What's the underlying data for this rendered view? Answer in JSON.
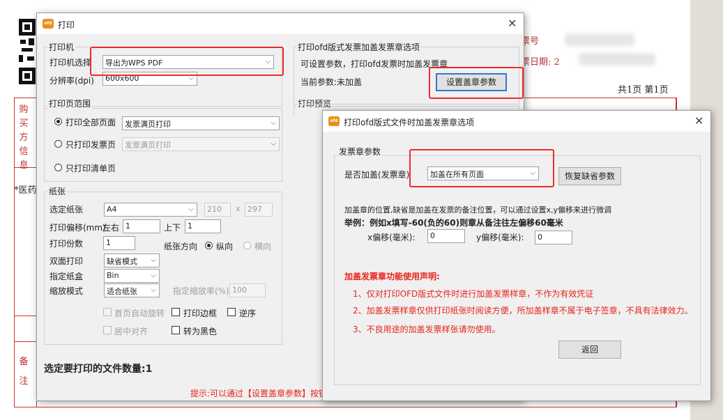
{
  "background_invoice": {
    "invoice_number_label": "票号",
    "invoice_date_label": "票日期: 2",
    "page_count": "共1页  第1页",
    "buyer_label_chars": [
      "购",
      "买",
      "方",
      "信",
      "息"
    ],
    "item_fragment": "*医药",
    "notes_label_chars": [
      "备",
      "注"
    ]
  },
  "print_dialog": {
    "title": "打印",
    "app_icon_label": "ofd",
    "printer_group": {
      "label": "打印机",
      "printer_select_label": "打印机选择",
      "printer_select_value": "导出为WPS PDF",
      "resolution_label": "分辨率(dpi)",
      "resolution_value": "600x600"
    },
    "stamp_options_group": {
      "label": "打印ofd版式发票加盖发票章选项",
      "description": "可设置参数，打印ofd发票时加盖发票章",
      "current_params": "当前参数:未加盖",
      "set_params_button": "设置盖章参数"
    },
    "range_group": {
      "label": "打印页范围",
      "all_pages_label": "打印全部页面",
      "all_pages_select": "发票满页打印",
      "invoice_only_label": "只打印发票页",
      "invoice_only_select": "发票满页打印",
      "list_only_label": "只打印清单页"
    },
    "preview_label": "打印预览",
    "paper_group": {
      "label": "纸张",
      "paper_select_label": "选定纸张",
      "paper_value": "A4",
      "paper_width": "210",
      "times": "x",
      "paper_height": "297",
      "offset_label": "打印偏移(mm)",
      "left_right_label": "左右",
      "left_right_value": "1",
      "up_down_label": "上下",
      "up_down_value": "1",
      "copies_label": "打印份数",
      "copies_value": "1",
      "orientation_label": "纸张方向",
      "portrait_label": "纵向",
      "landscape_label": "横向",
      "duplex_label": "双面打印",
      "duplex_value": "缺省模式",
      "tray_label": "指定纸盒",
      "tray_value": "Bin",
      "scale_mode_label": "缩放模式",
      "scale_mode_value": "适合纸张",
      "scale_ratio_label": "指定缩放率(%)",
      "scale_ratio_value": "100",
      "auto_rotate_label": "首页自动旋转",
      "print_border_label": "打印边框",
      "reverse_label": "逆序",
      "center_label": "居中对齐",
      "black_label": "转为黑色"
    },
    "file_count": "选定要打印的文件数量:1",
    "hint": "提示:可以通过【设置盖章参数】按钮"
  },
  "stamp_dialog": {
    "title": "打印ofd版式文件时加盖发票章选项",
    "app_icon_label": "ofd",
    "group_label": "发票章参数",
    "stamp_select_label": "是否加盖(发票章)",
    "stamp_select_value": "加盖在所有页面",
    "restore_button": "恢复缺省参数",
    "position_desc": "加盖章的位置,缺省是加盖在发票的备注位置，可以通过设置x,y偏移来进行微调",
    "example": "举例：例如x填写-60(负的60)则章从备注往左偏移60毫米",
    "x_offset_label": "x偏移(毫米):",
    "x_offset_value": "0",
    "y_offset_label": "y偏移(毫米):",
    "y_offset_value": "0",
    "statement_title": "加盖发票章功能使用声明:",
    "statement_1": "1、仅对打印OFD版式文件时进行加盖发票样章，不作为有效凭证",
    "statement_2": "2、加盖发票样章仅供打印纸张时阅读方便，所加盖样章不属于电子签章，不具有法律效力。",
    "statement_3": "3、不良用途的加盖发票样张请勿使用。",
    "back_button": "返回"
  },
  "icons": {
    "close": "✕",
    "chevron": "⌵",
    "qr": "qr-code-icon"
  },
  "colors": {
    "highlight_red": "#ee2a2a",
    "statement_red": "#e8231b",
    "focus_blue": "#2f78d0"
  }
}
